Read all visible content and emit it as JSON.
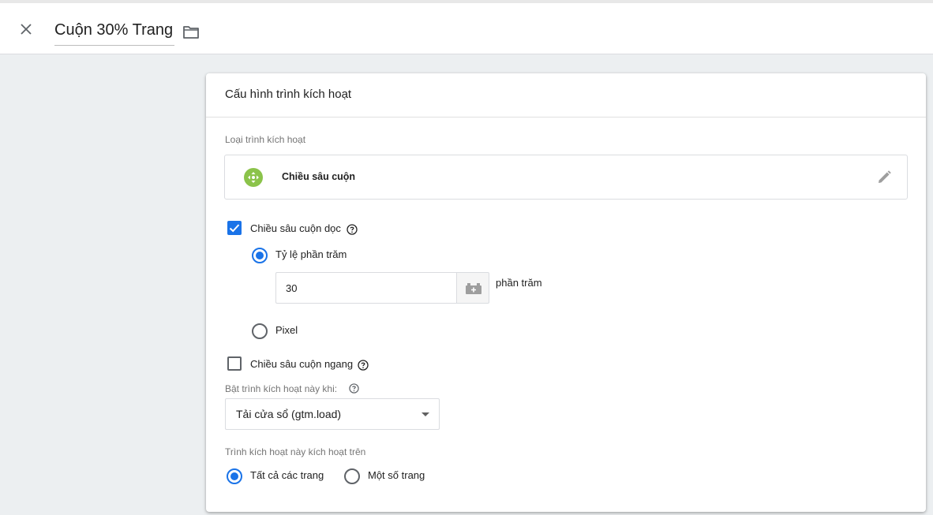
{
  "header": {
    "title": "Cuộn 30% Trang",
    "close_icon": "close-icon",
    "folder_icon": "folder-icon"
  },
  "card": {
    "title": "Cấu hình trình kích hoạt",
    "trigger_type": {
      "label": "Loại trình kích hoạt",
      "name": "Chiều sâu cuộn",
      "icon": "scroll-depth-icon",
      "icon_color": "#8bc34a",
      "edit_icon": "pencil-icon"
    },
    "vertical": {
      "label": "Chiều sâu cuộn dọc",
      "checked": true,
      "percent_option": "Tỷ lệ phần trăm",
      "percent_value": "30",
      "unit": "phần trăm",
      "pixel_option": "Pixel"
    },
    "horizontal": {
      "label": "Chiều sâu cuộn ngang",
      "checked": false
    },
    "enable_when": {
      "label": "Bật trình kích hoạt này khi:",
      "selected": "Tải cửa sổ (gtm.load)"
    },
    "fires_on": {
      "label": "Trình kích hoạt này kích hoạt trên",
      "options": [
        "Tất cả các trang",
        "Một số trang"
      ],
      "selected": "Tất cả các trang"
    }
  },
  "colors": {
    "accent": "#1a73e8",
    "background": "#eceff1"
  }
}
